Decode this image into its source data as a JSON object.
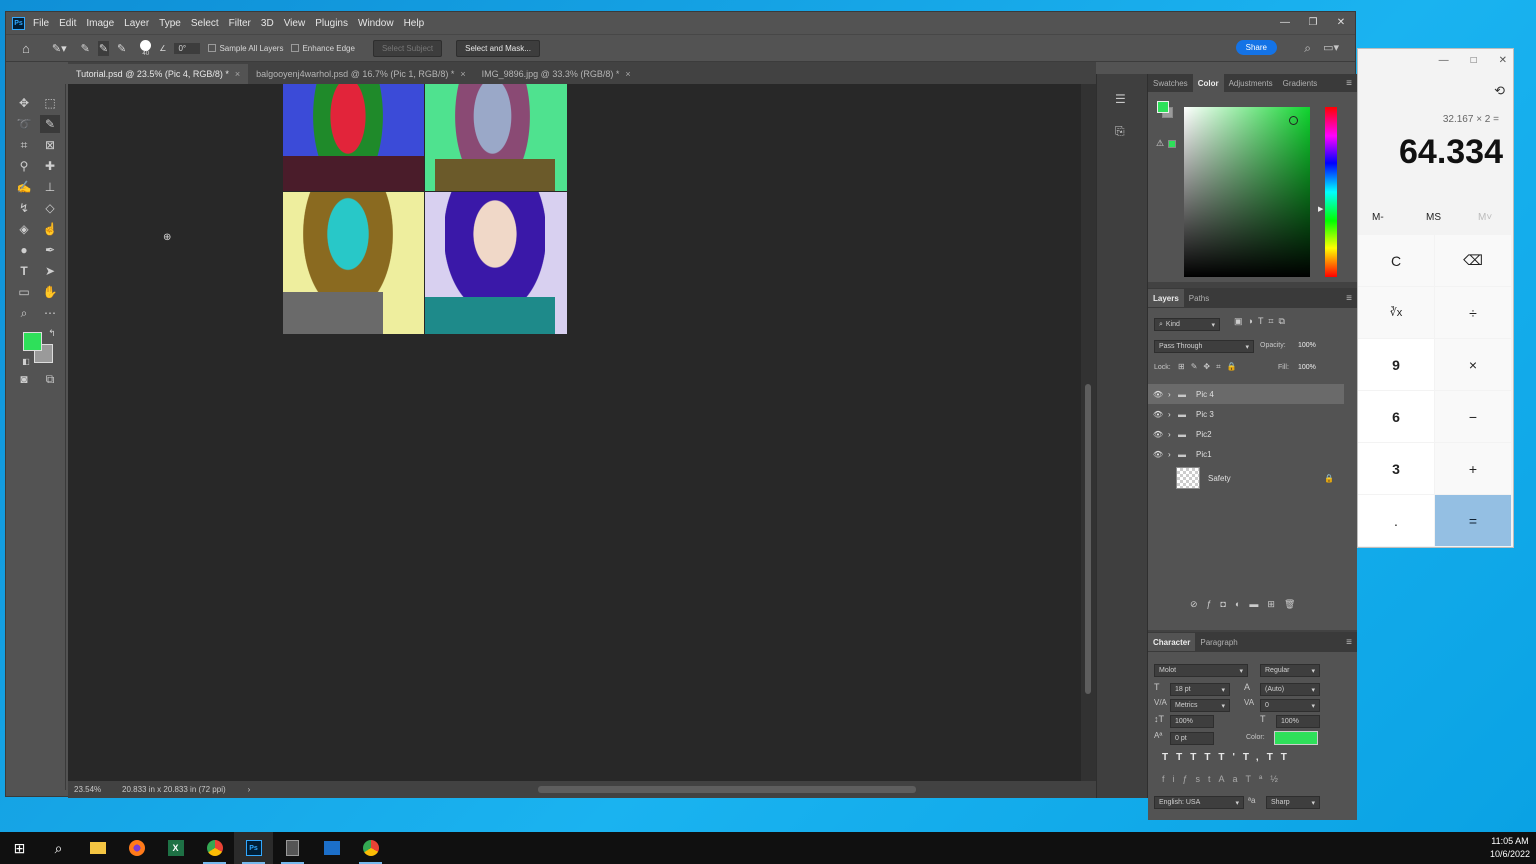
{
  "app": {
    "logo": "Ps",
    "menus": [
      "File",
      "Edit",
      "Image",
      "Layer",
      "Type",
      "Select",
      "Filter",
      "3D",
      "View",
      "Plugins",
      "Window",
      "Help"
    ]
  },
  "options": {
    "brush_size": "40",
    "angle": "0°",
    "sample_all_layers": "Sample All Layers",
    "enhance_edge": "Enhance Edge",
    "select_subject": "Select Subject",
    "select_and_mask": "Select and Mask...",
    "share": "Share"
  },
  "tabs": [
    {
      "label": "Tutorial.psd @ 23.5% (Pic 4, RGB/8) *"
    },
    {
      "label": "balgooyenj4warhol.psd @ 16.7% (Pic 1, RGB/8) *"
    },
    {
      "label": "IMG_9896.jpg @ 33.3% (RGB/8) *"
    }
  ],
  "status": {
    "zoom": "23.54%",
    "docsize": "20.833 in x 20.833 in (72 ppi)"
  },
  "color_panel": {
    "tabs": [
      "Swatches",
      "Color",
      "Adjustments",
      "Gradients"
    ],
    "foreground": "#2ee05a",
    "background": "#9a9a9a"
  },
  "layers_panel": {
    "tabs": [
      "Layers",
      "Paths"
    ],
    "filter": "Kind",
    "blend_mode": "Pass Through",
    "opacity_label": "Opacity:",
    "opacity": "100%",
    "lock_label": "Lock:",
    "fill_label": "Fill:",
    "fill": "100%",
    "layers": [
      {
        "name": "Pic 4",
        "type": "group"
      },
      {
        "name": "Pic 3",
        "type": "group"
      },
      {
        "name": "Pic2",
        "type": "group"
      },
      {
        "name": "Pic1",
        "type": "group"
      },
      {
        "name": "Safety",
        "type": "image"
      }
    ]
  },
  "character_panel": {
    "tabs": [
      "Character",
      "Paragraph"
    ],
    "font": "Molot",
    "style": "Regular",
    "size": "18 pt",
    "leading": "(Auto)",
    "kerning": "Metrics",
    "tracking": "0",
    "vscale": "100%",
    "hscale": "100%",
    "baseline": "0 pt",
    "color_label": "Color:",
    "color": "#2ee05a",
    "language": "English: USA",
    "antialias": "Sharp"
  },
  "calculator": {
    "expression": "32.167 × 2 =",
    "display": "64.334",
    "memory": [
      "M-",
      "MS",
      "M˅"
    ],
    "buttons": [
      "C",
      "⌫",
      "∛x",
      "÷",
      "9",
      "×",
      "6",
      "−",
      "3",
      "+",
      ".",
      "="
    ]
  },
  "taskbar": {
    "time": "11:05 AM",
    "date": "10/6/2022"
  }
}
